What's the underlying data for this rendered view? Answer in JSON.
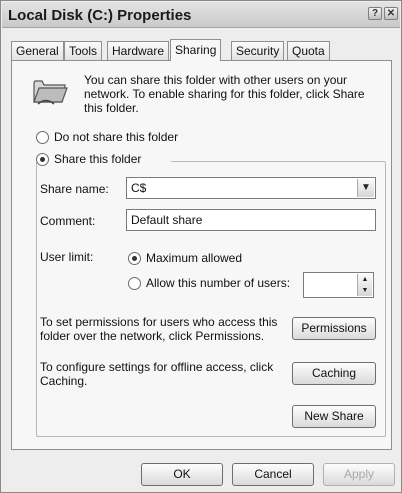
{
  "window": {
    "title": "Local Disk (C:) Properties",
    "help_glyph": "?",
    "close_glyph": "✕"
  },
  "tabs": [
    {
      "label": "General",
      "active": false
    },
    {
      "label": "Tools",
      "active": false
    },
    {
      "label": "Hardware",
      "active": false
    },
    {
      "label": "Sharing",
      "active": true
    },
    {
      "label": "Security",
      "active": false
    },
    {
      "label": "Quota",
      "active": false
    }
  ],
  "sharing": {
    "intro_text": "You can share this folder with other users on your network.  To enable sharing for this folder, click Share this folder.",
    "do_not_share_label": "Do not share this folder",
    "share_label": "Share this folder",
    "share_selected": true,
    "share_name_label": "Share name:",
    "share_name_value": "C$",
    "comment_label": "Comment:",
    "comment_value": "Default share",
    "user_limit_label": "User limit:",
    "max_allowed_label": "Maximum allowed",
    "max_allowed_selected": true,
    "allow_number_label": "Allow this number of users:",
    "allow_number_value": "",
    "permissions_text": "To set permissions for users who access this folder over the network, click Permissions.",
    "permissions_button": "Permissions",
    "caching_text": "To configure settings for offline access, click Caching.",
    "caching_button": "Caching",
    "new_share_button": "New Share"
  },
  "footer": {
    "ok_label": "OK",
    "cancel_label": "Cancel",
    "apply_label": "Apply"
  }
}
